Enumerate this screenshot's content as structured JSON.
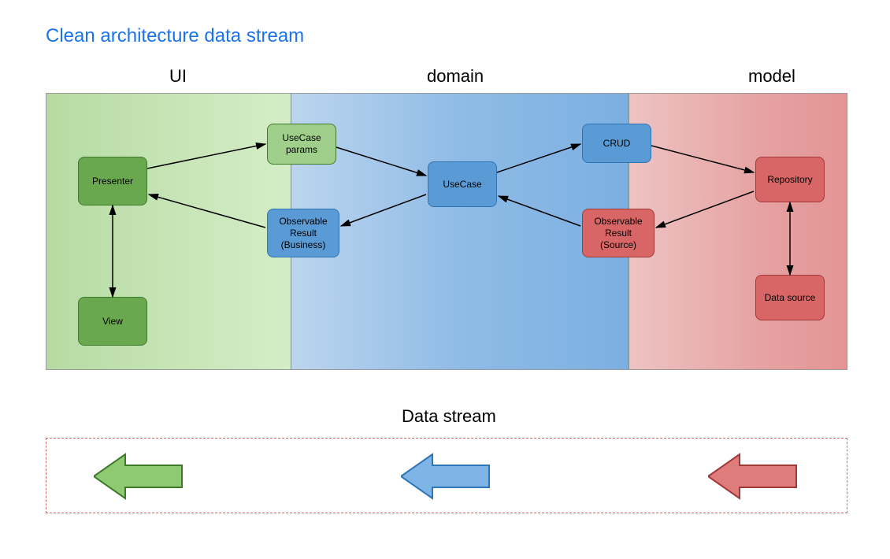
{
  "title": "Clean architecture data stream",
  "zones": {
    "ui": "UI",
    "domain": "domain",
    "model": "model"
  },
  "nodes": {
    "presenter": "Presenter",
    "view": "View",
    "usecase_params": "UseCase\nparams",
    "observable_business": "Observable\nResult\n(Business)",
    "usecase": "UseCase",
    "crud": "CRUD",
    "observable_source": "Observable\nResult\n(Source)",
    "repository": "Repository",
    "datasource": "Data source"
  },
  "datastream_label": "Data stream",
  "edges": [
    {
      "from": "presenter",
      "to": "view",
      "dir": "both"
    },
    {
      "from": "presenter",
      "to": "usecase_params",
      "dir": "forward"
    },
    {
      "from": "observable_business",
      "to": "presenter",
      "dir": "forward"
    },
    {
      "from": "usecase_params",
      "to": "usecase",
      "dir": "forward"
    },
    {
      "from": "usecase",
      "to": "observable_business",
      "dir": "forward"
    },
    {
      "from": "usecase",
      "to": "crud",
      "dir": "forward"
    },
    {
      "from": "observable_source",
      "to": "usecase",
      "dir": "forward"
    },
    {
      "from": "crud",
      "to": "repository",
      "dir": "forward"
    },
    {
      "from": "repository",
      "to": "observable_source",
      "dir": "forward"
    },
    {
      "from": "repository",
      "to": "datasource",
      "dir": "both"
    }
  ],
  "colors": {
    "green_fill": "#6aa84f",
    "green_stroke": "#3d7a2a",
    "blue_fill": "#5b9bd5",
    "blue_stroke": "#2e75b6",
    "red_fill": "#d96666",
    "red_stroke": "#a23939",
    "title_blue": "#1a73e8"
  }
}
